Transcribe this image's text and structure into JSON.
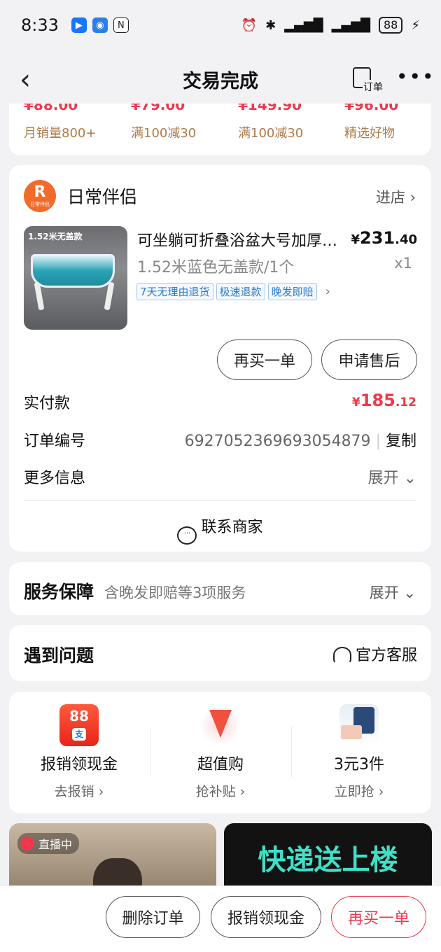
{
  "status_bar": {
    "time": "8:33",
    "battery": "88"
  },
  "nav": {
    "title": "交易完成",
    "order_label": "订单"
  },
  "recommendations": [
    {
      "price": "¥88.00",
      "tag": "月销量800+"
    },
    {
      "price": "¥79.00",
      "tag": "满100减30"
    },
    {
      "price": "¥149.90",
      "tag": "满100减30"
    },
    {
      "price": "¥96.00",
      "tag": "精选好物"
    }
  ],
  "store": {
    "logo_letter": "R",
    "logo_caption": "日常伴侣",
    "name": "日常伴侣",
    "enter_label": "进店",
    "product": {
      "image_tag": "1.52米无盖款",
      "title": "可坐躺可折叠浴盆大号加厚成人泡澡桶",
      "price_currency": "¥",
      "price_int": "231",
      "price_dec": ".40",
      "spec": "1.52米蓝色无盖款/1个",
      "qty": "x1",
      "tags": [
        "7天无理由退货",
        "极速退款",
        "晚发即赔"
      ]
    },
    "buy_again_label": "再买一单",
    "after_sales_label": "申请售后",
    "paid": {
      "label": "实付款",
      "currency": "¥",
      "int": "185",
      "dec": ".12"
    },
    "order_no": {
      "label": "订单编号",
      "value": "6927052369693054879",
      "copy_label": "复制"
    },
    "more_info": {
      "label": "更多信息",
      "expand_label": "展开"
    },
    "contact_label": "联系商家"
  },
  "service": {
    "title": "服务保障",
    "desc": "含晚发即赔等3项服务",
    "expand_label": "展开"
  },
  "problem": {
    "title": "遇到问题",
    "cs_label": "官方客服"
  },
  "promos": [
    {
      "icon": "cash-reward-icon",
      "icon_text": "88",
      "icon_sub": "支",
      "name": "报销领现金",
      "sub": "去报销"
    },
    {
      "icon": "down-arrow-deal-icon",
      "name": "超值购",
      "sub": "抢补贴"
    },
    {
      "icon": "goods-bundle-icon",
      "name": "3元3件",
      "sub": "立即抢"
    }
  ],
  "feed": {
    "live_label": "直播中",
    "express_text": "快递送上楼"
  },
  "bottom_bar": {
    "delete_label": "删除订单",
    "cash_label": "报销领现金",
    "buy_again_label": "再买一单"
  },
  "colors": {
    "accent_red": "#f0384a",
    "tag_blue": "#2a7bc7",
    "teal": "#3fe0c8"
  }
}
